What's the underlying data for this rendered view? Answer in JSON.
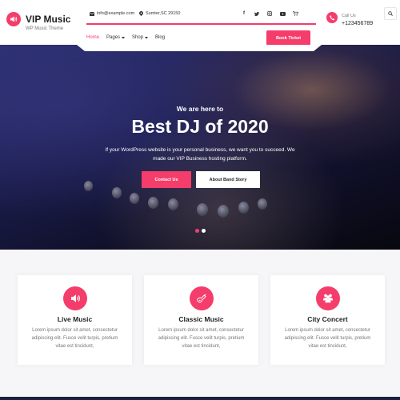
{
  "brand": {
    "title": "VIP Music",
    "tagline": "WP Music Theme",
    "icon": "music-volume-icon"
  },
  "topbar": {
    "email": "info@example.com",
    "location": "Sumter,SC 29150",
    "social": [
      "facebook-icon",
      "twitter-icon",
      "instagram-icon",
      "youtube-icon",
      "cart-icon"
    ],
    "search_icon": "search-icon"
  },
  "nav": {
    "items": [
      {
        "label": "Home",
        "active": true,
        "dropdown": false
      },
      {
        "label": "Pages",
        "active": false,
        "dropdown": true
      },
      {
        "label": "Shop",
        "active": false,
        "dropdown": true
      },
      {
        "label": "Blog",
        "active": false,
        "dropdown": false
      }
    ],
    "cta": "Book Ticket"
  },
  "call": {
    "label": "Call Us",
    "number": "+123456789"
  },
  "hero": {
    "subtitle": "We are here to",
    "title": "Best DJ of 2020",
    "description": "If your WordPress website is your personal business, we want you to succeed. We made our VIP Business hosting platform.",
    "primary_button": "Contact Us",
    "secondary_button": "About Band Story",
    "slides": 2,
    "active_slide": 1
  },
  "features": [
    {
      "title": "Live Music",
      "icon": "speaker-icon",
      "text": "Lorem ipsum dolor sit amet, consectetur adipiscing elit. Fusce velit turpis, pretium vitae est tincidunt,"
    },
    {
      "title": "Classic Music",
      "icon": "guitar-icon",
      "text": "Lorem ipsum dolor sit amet, consectetur adipiscing elit. Fusce velit turpis, pretium vitae est tincidunt,"
    },
    {
      "title": "City Concert",
      "icon": "crowd-icon",
      "text": "Lorem ipsum dolor sit amet, consectetur adipiscing elit. Fusce velit turpis, pretium vitae est tincidunt,"
    }
  ],
  "colors": {
    "accent": "#f43d6a",
    "dark": "#1a1c4a"
  }
}
